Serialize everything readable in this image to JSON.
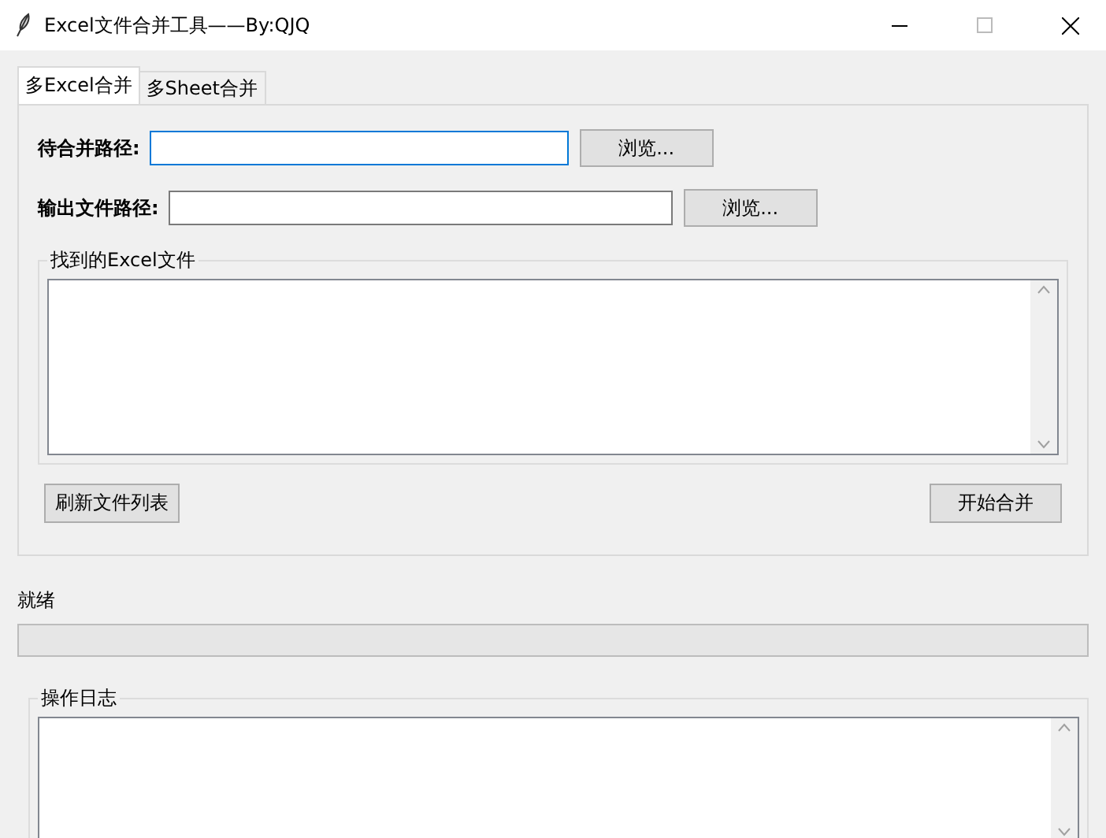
{
  "window": {
    "title": "Excel文件合并工具——By:QJQ"
  },
  "tabs": [
    {
      "label": "多Excel合并",
      "selected": true
    },
    {
      "label": "多Sheet合并",
      "selected": false
    }
  ],
  "fields": [
    {
      "label": "待合并路径:",
      "focused": true,
      "button": "浏览..."
    },
    {
      "label": "输出文件路径:",
      "focused": false,
      "button": "浏览..."
    }
  ],
  "file_list": {
    "title": "找到的Excel文件"
  },
  "actions": {
    "refresh": "刷新文件列表",
    "merge": "开始合并"
  },
  "status": {
    "text": "就绪",
    "level": 0
  },
  "log": {
    "title": "操作日志"
  }
}
